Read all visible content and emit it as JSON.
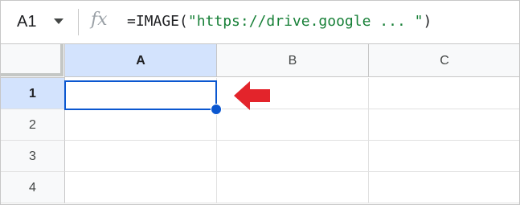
{
  "formula_bar": {
    "cell_ref": "A1",
    "fx_icon": "fx",
    "formula_prefix": "=IMAGE(",
    "formula_string": "\"https://drive.google ... \"",
    "formula_suffix": ")"
  },
  "columns": [
    "A",
    "B",
    "C"
  ],
  "rows": [
    "1",
    "2",
    "3",
    "4"
  ],
  "selection": {
    "cell": "A1",
    "color": "#0b57d0"
  },
  "annotation": {
    "arrow_color": "#e3242b"
  }
}
